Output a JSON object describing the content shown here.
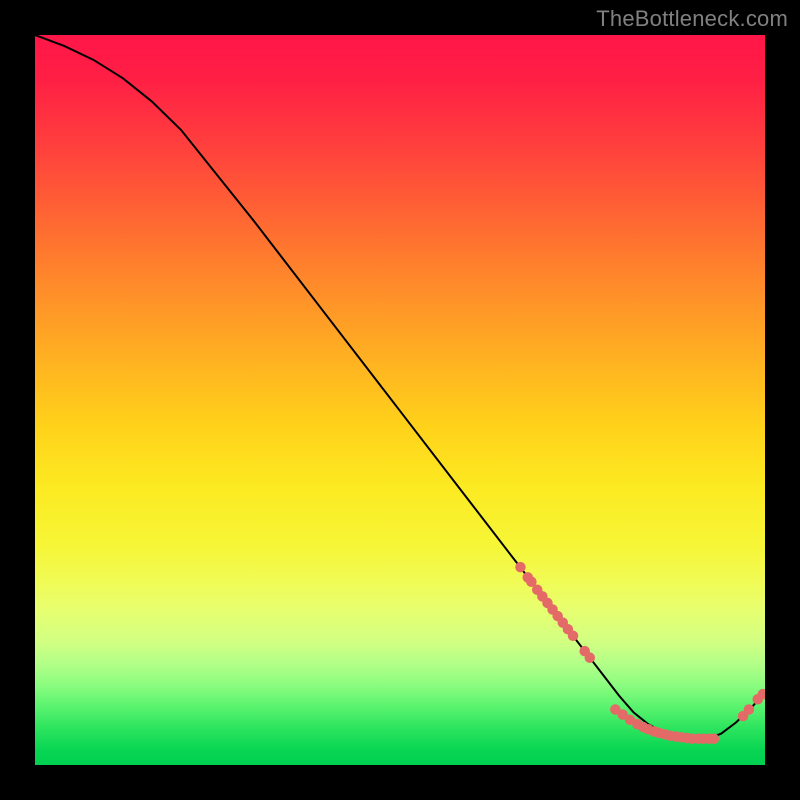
{
  "watermark": "TheBottleneck.com",
  "chart_data": {
    "type": "line",
    "title": "",
    "xlabel": "",
    "ylabel": "",
    "xlim": [
      0,
      100
    ],
    "ylim": [
      0,
      100
    ],
    "grid": false,
    "legend": false,
    "series": [
      {
        "name": "curve",
        "color": "#000000",
        "x": [
          0,
          4,
          8,
          12,
          16,
          20,
          30,
          40,
          50,
          60,
          66,
          68,
          70,
          72,
          74,
          76,
          78,
          80,
          82,
          84,
          86,
          88,
          90,
          92,
          94,
          96,
          98,
          100
        ],
        "y": [
          100,
          98.5,
          96.6,
          94.1,
          90.9,
          87.0,
          74.5,
          61.5,
          48.5,
          35.5,
          27.7,
          25.1,
          22.5,
          19.9,
          17.3,
          14.7,
          12.1,
          9.5,
          7.2,
          5.6,
          4.5,
          3.8,
          3.5,
          3.5,
          4.3,
          5.8,
          7.7,
          10.0
        ]
      }
    ],
    "markers": [
      {
        "name": "points-descent",
        "color": "#e46a67",
        "x": [
          66.5,
          67.5,
          68.0,
          68.8,
          69.5,
          70.2,
          70.9,
          71.6,
          72.3,
          73.0,
          73.7,
          75.3,
          76.0
        ],
        "y": [
          27.1,
          25.7,
          25.1,
          24.0,
          23.1,
          22.2,
          21.3,
          20.4,
          19.5,
          18.6,
          17.7,
          15.6,
          14.7
        ]
      },
      {
        "name": "points-valley",
        "color": "#e46a67",
        "x": [
          79.5,
          80.5,
          81.5,
          82.5,
          83.3,
          84.0,
          84.8,
          85.5,
          86.3,
          87.0,
          87.8,
          88.5,
          89.3,
          90.0,
          90.8,
          91.5,
          92.3,
          93.0
        ],
        "y": [
          7.6,
          6.9,
          6.2,
          5.6,
          5.2,
          4.9,
          4.6,
          4.4,
          4.2,
          4.0,
          3.9,
          3.8,
          3.7,
          3.6,
          3.6,
          3.6,
          3.6,
          3.6
        ]
      },
      {
        "name": "points-rise",
        "color": "#e46a67",
        "x": [
          97.0,
          97.8,
          99.0,
          99.7
        ],
        "y": [
          6.7,
          7.6,
          9.0,
          9.7
        ]
      }
    ],
    "gradient_colors": {
      "top": "#ff1648",
      "mid_upper": "#ff9927",
      "mid": "#fcea22",
      "mid_lower": "#f0fb56",
      "bottom": "#00cf50"
    }
  }
}
